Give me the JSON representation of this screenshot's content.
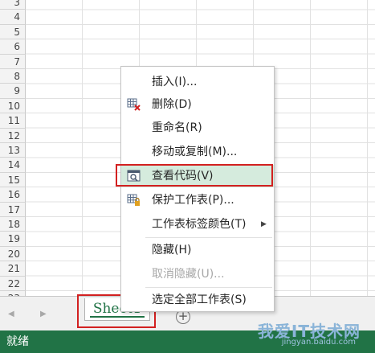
{
  "row_numbers": [
    "3",
    "4",
    "5",
    "6",
    "7",
    "8",
    "9",
    "10",
    "11",
    "12",
    "13",
    "14",
    "15",
    "16",
    "17",
    "18",
    "19",
    "20",
    "21",
    "22",
    "23"
  ],
  "context_menu": {
    "items": [
      {
        "label": "插入(I)...",
        "icon": "",
        "disabled": false
      },
      {
        "label": "删除(D)",
        "icon": "delete-sheet-icon",
        "disabled": false
      },
      {
        "label": "重命名(R)",
        "icon": "",
        "disabled": false
      },
      {
        "label": "移动或复制(M)...",
        "icon": "",
        "disabled": false
      },
      {
        "label": "查看代码(V)",
        "icon": "view-code-icon",
        "disabled": false,
        "hovered": true
      },
      {
        "label": "保护工作表(P)...",
        "icon": "protect-sheet-icon",
        "disabled": false
      },
      {
        "label": "工作表标签颜色(T)",
        "icon": "",
        "disabled": false,
        "submenu": true
      },
      {
        "label": "隐藏(H)",
        "icon": "",
        "disabled": false
      },
      {
        "label": "取消隐藏(U)...",
        "icon": "",
        "disabled": true
      },
      {
        "label": "选定全部工作表(S)",
        "icon": "",
        "disabled": false
      }
    ]
  },
  "sheet_tabs": [
    "Sheet1"
  ],
  "add_sheet_label": "+",
  "status": "就绪",
  "watermark": {
    "text": "我爱IT技术网",
    "url": "jingyan.baidu.com"
  },
  "colors": {
    "accent": "#217346",
    "highlight_box": "#d22020",
    "menu_hover": "#d5ebdd"
  }
}
